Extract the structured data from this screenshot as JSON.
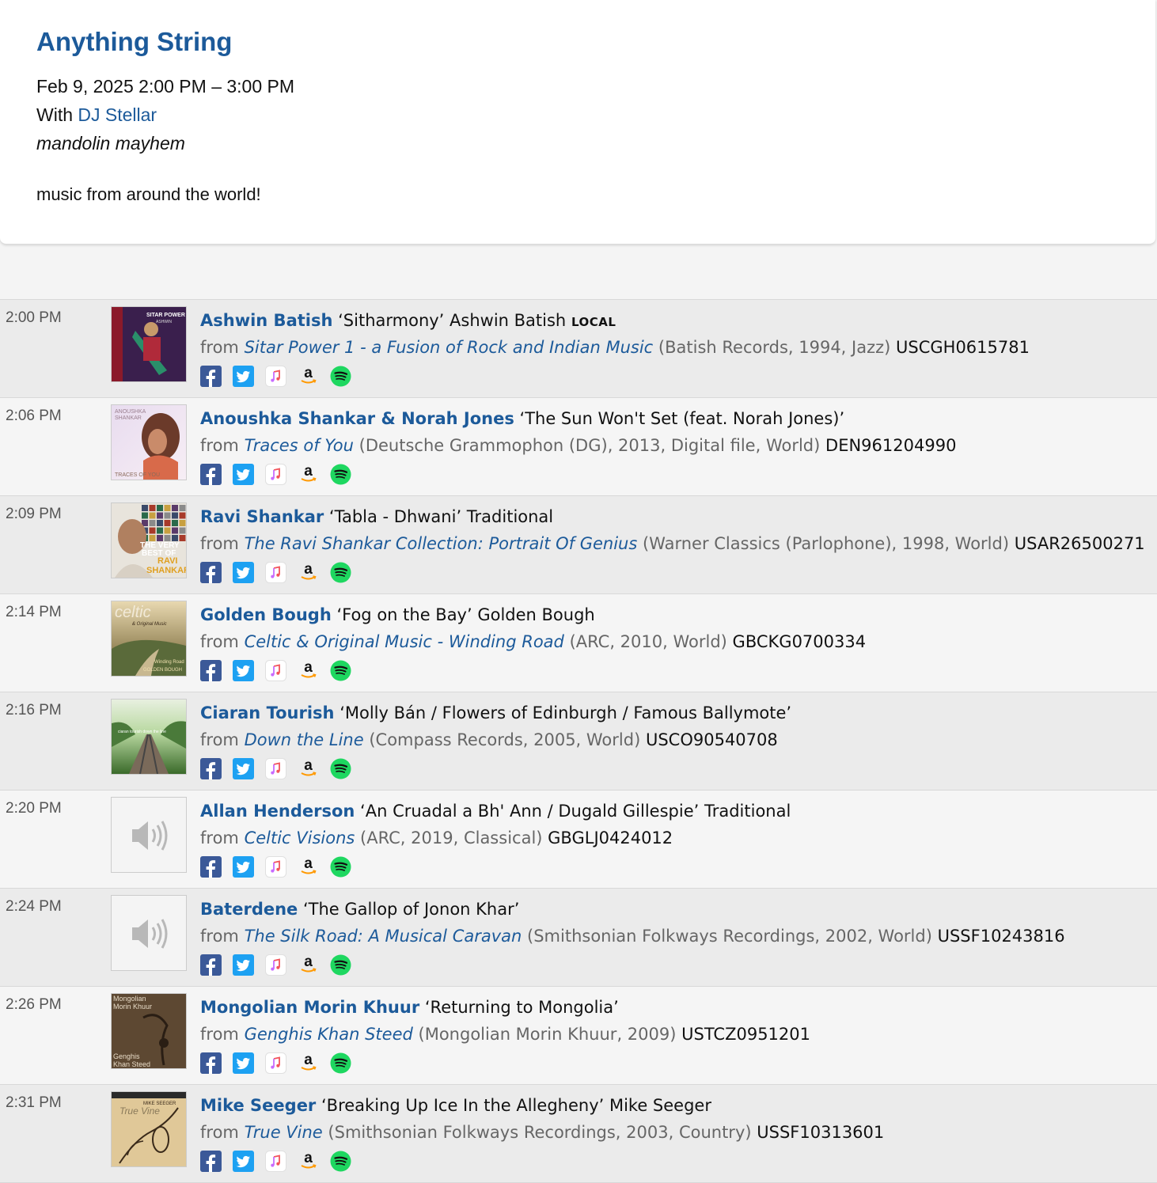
{
  "show": {
    "title": "Anything String",
    "datetime": "Feb 9, 2025 2:00 PM – 3:00 PM",
    "with_prefix": "With",
    "dj": "DJ Stellar",
    "subtitle": "mandolin mayhem",
    "description": "music from around the world!"
  },
  "colors": {
    "link": "#1c5a9a",
    "row_odd": "#ebebeb",
    "row_even": "#f5f5f5",
    "facebook": "#3b5998",
    "twitter": "#1da1f2",
    "spotify": "#1ed760",
    "amazon_arrow": "#ff9900"
  },
  "share_icons": [
    "facebook-icon",
    "twitter-icon",
    "apple-music-icon",
    "amazon-icon",
    "spotify-icon"
  ],
  "spins": [
    {
      "time": "2:00 PM",
      "artist": "Ashwin Batish",
      "song": "‘Sitharmony’ Ashwin Batish",
      "badge": "LOCAL",
      "from": "from",
      "release": "Sitar Power 1 - a Fusion of Rock and Indian Music",
      "details": "(Batish Records, 1994, Jazz)",
      "isrc": "USCGH0615781",
      "art": "sitar-power-cover"
    },
    {
      "time": "2:06 PM",
      "artist": "Anoushka Shankar & Norah Jones",
      "song": "‘The Sun Won't Set (feat. Norah Jones)’",
      "badge": "",
      "from": "from",
      "release": "Traces of You",
      "details": "(Deutsche Grammophon (DG), 2013, Digital file, World)",
      "isrc": "DEN961204990",
      "art": "traces-of-you-cover"
    },
    {
      "time": "2:09 PM",
      "artist": "Ravi Shankar",
      "song": "‘Tabla - Dhwani’ Traditional",
      "badge": "",
      "from": "from",
      "release": "The Ravi Shankar Collection: Portrait Of Genius",
      "details": "(Warner Classics (Parlophone), 1998, World)",
      "isrc": "USAR26500271",
      "art": "ravi-shankar-cover"
    },
    {
      "time": "2:14 PM",
      "artist": "Golden Bough",
      "song": "‘Fog on the Bay’ Golden Bough",
      "badge": "",
      "from": "from",
      "release": "Celtic & Original Music - Winding Road",
      "details": "(ARC, 2010, World)",
      "isrc": "GBCKG0700334",
      "art": "celtic-cover"
    },
    {
      "time": "2:16 PM",
      "artist": "Ciaran Tourish",
      "song": "‘Molly Bán / Flowers of Edinburgh / Famous Ballymote’",
      "badge": "",
      "from": "from",
      "release": "Down the Line",
      "details": "(Compass Records, 2005, World)",
      "isrc": "USCO90540708",
      "art": "down-the-line-cover"
    },
    {
      "time": "2:20 PM",
      "artist": "Allan Henderson",
      "song": "‘An Cruadal a Bh' Ann / Dugald Gillespie’ Traditional",
      "badge": "",
      "from": "from",
      "release": "Celtic Visions",
      "details": "(ARC, 2019, Classical)",
      "isrc": "GBGLJ0424012",
      "art": "placeholder"
    },
    {
      "time": "2:24 PM",
      "artist": "Baterdene",
      "song": "‘The Gallop of Jonon Khar’",
      "badge": "",
      "from": "from",
      "release": "The Silk Road: A Musical Caravan",
      "details": "(Smithsonian Folkways Recordings, 2002, World)",
      "isrc": "USSF10243816",
      "art": "placeholder"
    },
    {
      "time": "2:26 PM",
      "artist": "Mongolian Morin Khuur",
      "song": "‘Returning to Mongolia’",
      "badge": "",
      "from": "from",
      "release": "Genghis Khan Steed",
      "details": "(Mongolian Morin Khuur, 2009)",
      "isrc": "USTCZ0951201",
      "art": "genghis-cover"
    },
    {
      "time": "2:31 PM",
      "artist": "Mike Seeger",
      "song": "‘Breaking Up Ice In the Allegheny’ Mike Seeger",
      "badge": "",
      "from": "from",
      "release": "True Vine",
      "details": "(Smithsonian Folkways Recordings, 2003, Country)",
      "isrc": "USSF10313601",
      "art": "true-vine-cover"
    }
  ],
  "cover_text": {
    "sitar": [
      "SITAR POWER",
      "ASHWIN BATISH"
    ],
    "traces": [
      "ANOUSHKA",
      "SHANKAR",
      "TRACES OF YOU"
    ],
    "ravi": [
      "THE VERY",
      "BEST OF",
      "RAVI",
      "SHANKAR"
    ],
    "celtic": [
      "celtic",
      "& Original Music",
      "Winding Road",
      "GOLDEN BOUGH"
    ],
    "downline": [
      "ciaran tourish down the line"
    ],
    "genghis": [
      "Mongolian",
      "Morin Khuur",
      "Genghis",
      "Khan Steed"
    ],
    "truevine": [
      "MIKE SEEGER",
      "True Vine"
    ]
  }
}
